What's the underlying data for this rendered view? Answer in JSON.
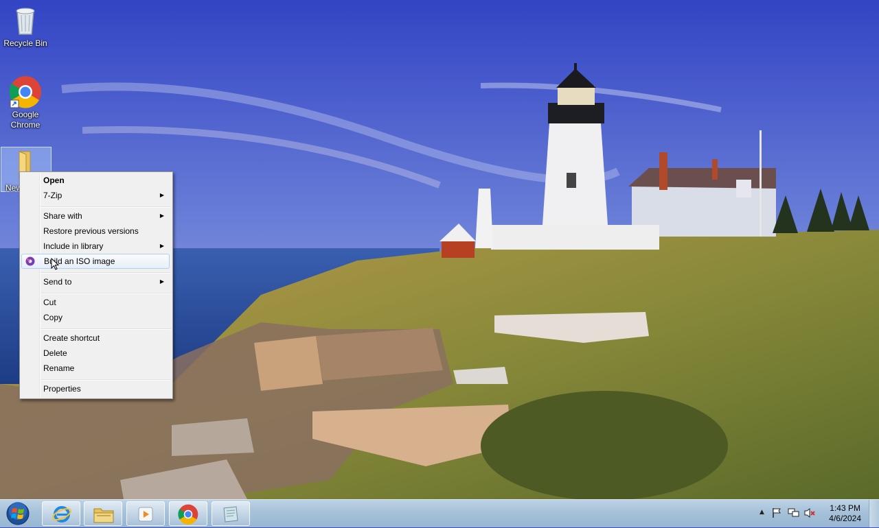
{
  "desktop": {
    "icons": [
      {
        "label": "Recycle Bin",
        "icon": "recycle-bin-icon"
      },
      {
        "label": "Google Chrome",
        "icon": "chrome-icon"
      },
      {
        "label": "New",
        "icon": "folder-icon"
      }
    ]
  },
  "context_menu": {
    "items": [
      {
        "label": "Open",
        "bold": true
      },
      {
        "label": "7-Zip",
        "submenu": true
      },
      {
        "label": "Share with",
        "submenu": true
      },
      {
        "label": "Restore previous versions"
      },
      {
        "label": "Include in library",
        "submenu": true
      },
      {
        "label": "Build an ISO image",
        "icon": "iso-tool-icon",
        "highlighted": true
      },
      {
        "label": "Send to",
        "submenu": true
      },
      {
        "label": "Cut"
      },
      {
        "label": "Copy"
      },
      {
        "label": "Create shortcut"
      },
      {
        "label": "Delete"
      },
      {
        "label": "Rename"
      },
      {
        "label": "Properties"
      }
    ]
  },
  "taskbar": {
    "pinned": [
      {
        "name": "internet-explorer-icon"
      },
      {
        "name": "file-explorer-icon"
      },
      {
        "name": "media-player-icon"
      },
      {
        "name": "chrome-icon"
      },
      {
        "name": "app-icon"
      }
    ],
    "tray": {
      "time": "1:43 PM",
      "date": "4/6/2024",
      "icons": [
        "show-hidden-icons",
        "action-center-flag-icon",
        "network-icon",
        "volume-muted-icon"
      ]
    }
  },
  "colors": {
    "taskbar": "#a6c1d9",
    "menu_bg": "#f0f0f0",
    "menu_highlight": "#aecff7"
  }
}
